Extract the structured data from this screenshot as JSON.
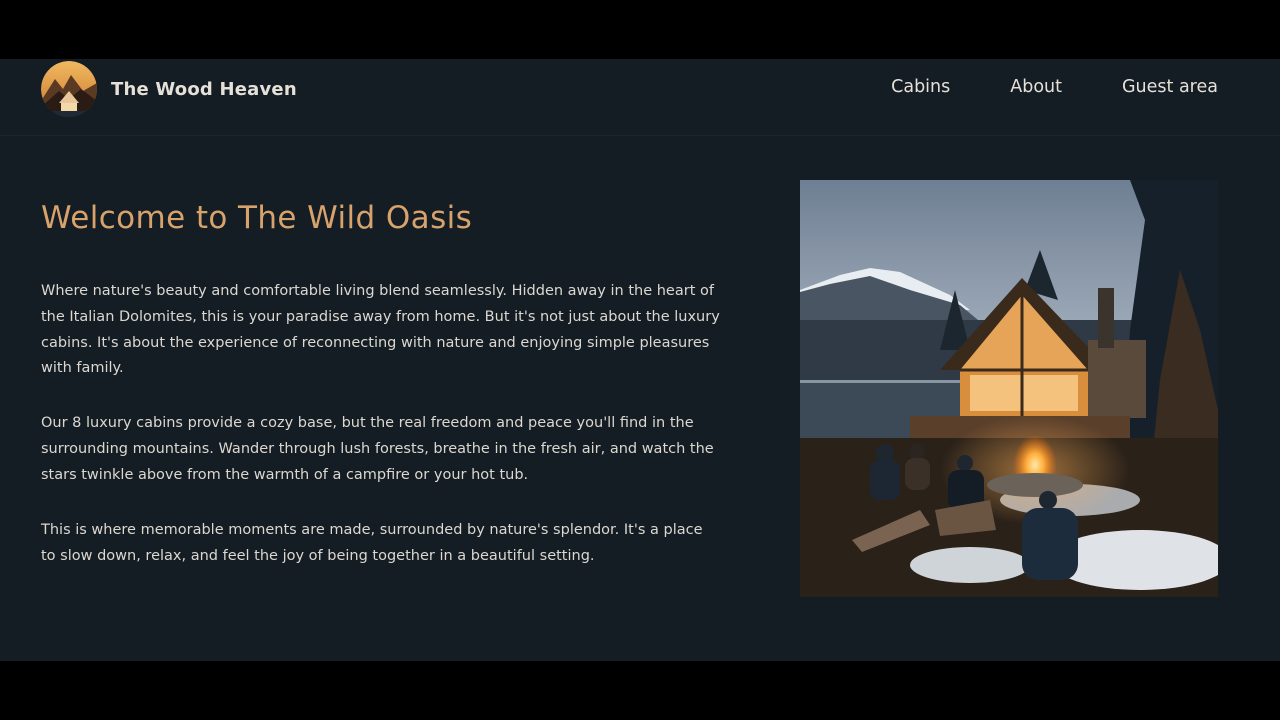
{
  "header": {
    "brand_name": "The Wood Heaven",
    "logo_icon": "cabin-logo-icon",
    "nav": [
      {
        "label": "Cabins"
      },
      {
        "label": "About"
      },
      {
        "label": "Guest area"
      }
    ]
  },
  "main": {
    "title": "Welcome to The Wild Oasis",
    "paragraphs": [
      "Where nature's beauty and comfortable living blend seamlessly. Hidden away in the heart of the Italian Dolomites, this is your paradise away from home. But it's not just about the luxury cabins. It's about the experience of reconnecting with nature and enjoying simple pleasures with family.",
      "Our 8 luxury cabins provide a cozy base, but the real freedom and peace you'll find in the surrounding mountains. Wander through lush forests, breathe in the fresh air, and watch the stars twinkle above from the warmth of a campfire or your hot tub.",
      "This is where memorable moments are made, surrounded by nature's splendor. It's a place to slow down, relax, and feel the joy of being together in a beautiful setting."
    ],
    "image_subject": "lakeside-cabin-campfire-image"
  },
  "colors": {
    "background": "#141c24",
    "accent": "#d7a26b",
    "text": "#dcd8d0"
  }
}
